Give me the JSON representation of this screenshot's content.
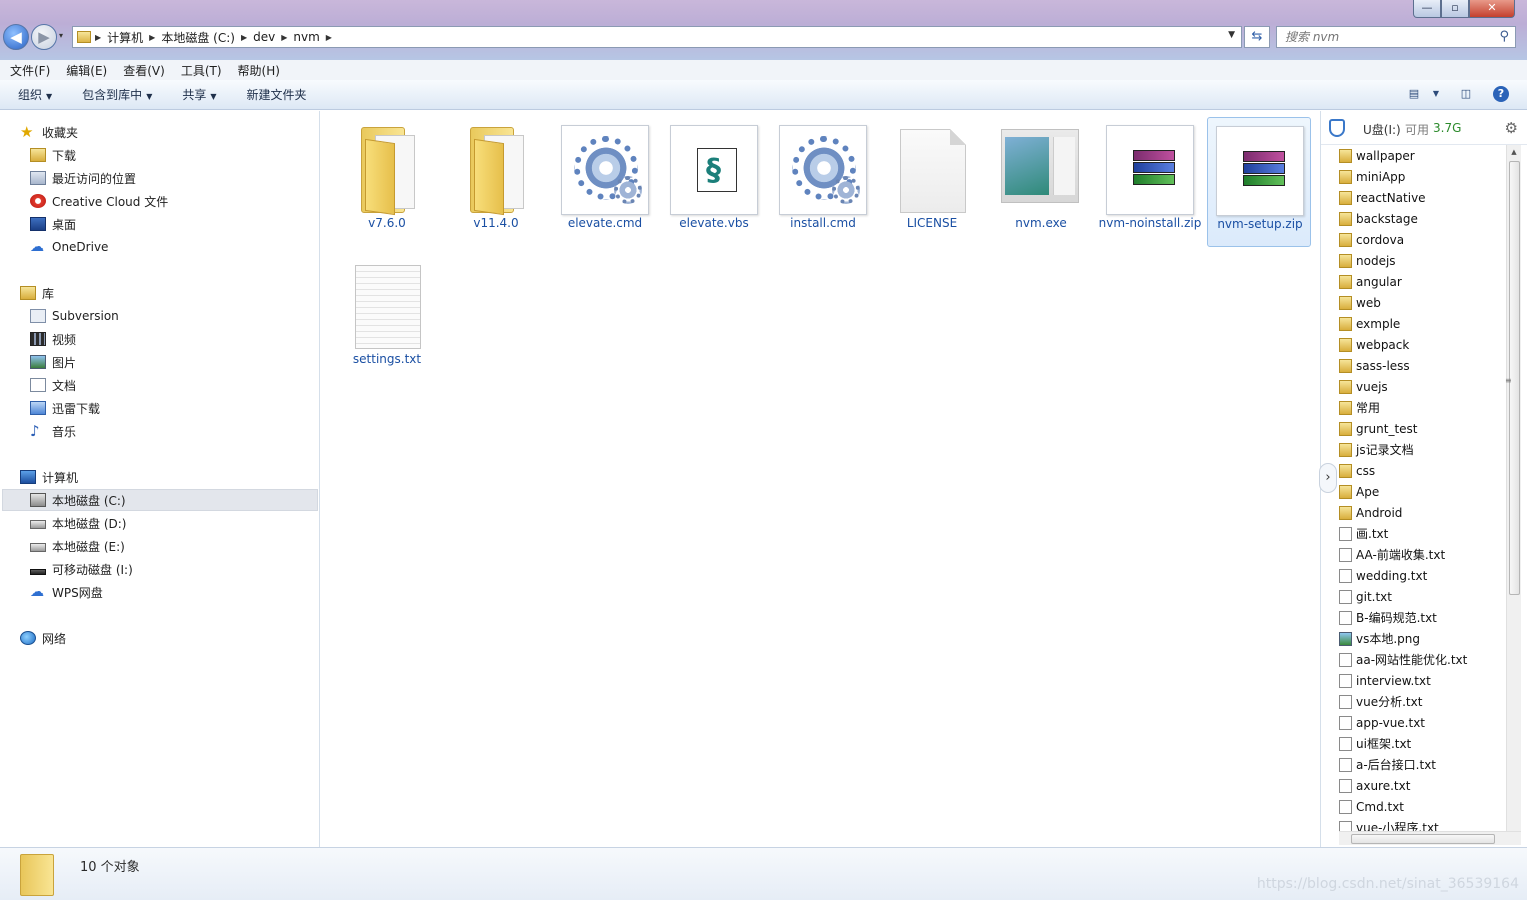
{
  "window": {
    "controls": {
      "minimize": "—",
      "maximize": "▫",
      "close": "✕"
    }
  },
  "navigation": {
    "back": "◀",
    "forward": "▶",
    "history": "▾",
    "breadcrumbs": [
      "计算机",
      "本地磁盘 (C:)",
      "dev",
      "nvm"
    ],
    "search_placeholder": "搜索 nvm"
  },
  "menubar": [
    "文件(F)",
    "编辑(E)",
    "查看(V)",
    "工具(T)",
    "帮助(H)"
  ],
  "commandbar": {
    "organize": "组织",
    "include_library": "包含到库中",
    "share": "共享",
    "new_folder": "新建文件夹"
  },
  "sidebar": {
    "favorites": {
      "header": "收藏夹",
      "items": [
        "下载",
        "最近访问的位置",
        "Creative Cloud 文件",
        "桌面",
        "OneDrive"
      ]
    },
    "libraries": {
      "header": "库",
      "items": [
        "Subversion",
        "视频",
        "图片",
        "文档",
        "迅雷下载",
        "音乐"
      ]
    },
    "computer": {
      "header": "计算机",
      "items": [
        "本地磁盘 (C:)",
        "本地磁盘 (D:)",
        "本地磁盘 (E:)",
        "可移动磁盘 (I:)",
        "WPS网盘"
      ],
      "selected": "本地磁盘 (C:)"
    },
    "network": {
      "header": "网络"
    }
  },
  "files": [
    {
      "name": "v7.6.0",
      "type": "folder"
    },
    {
      "name": "v11.4.0",
      "type": "folder"
    },
    {
      "name": "elevate.cmd",
      "type": "cmd"
    },
    {
      "name": "elevate.vbs",
      "type": "vbs"
    },
    {
      "name": "install.cmd",
      "type": "cmd"
    },
    {
      "name": "LICENSE",
      "type": "blank"
    },
    {
      "name": "nvm.exe",
      "type": "exe"
    },
    {
      "name": "nvm-noinstall.zip",
      "type": "zip"
    },
    {
      "name": "nvm-setup.zip",
      "type": "zip",
      "selected": true
    },
    {
      "name": "settings.txt",
      "type": "txt"
    }
  ],
  "preview": {
    "drive": "U盘(I:)",
    "free_label": "可用",
    "free_value": "3.7G",
    "items": [
      {
        "name": "wallpaper",
        "kind": "folder"
      },
      {
        "name": "miniApp",
        "kind": "folder"
      },
      {
        "name": "reactNative",
        "kind": "folder"
      },
      {
        "name": "backstage",
        "kind": "folder"
      },
      {
        "name": "cordova",
        "kind": "folder"
      },
      {
        "name": "nodejs",
        "kind": "folder"
      },
      {
        "name": "angular",
        "kind": "folder"
      },
      {
        "name": "web",
        "kind": "folder"
      },
      {
        "name": "exmple",
        "kind": "folder"
      },
      {
        "name": "webpack",
        "kind": "folder"
      },
      {
        "name": "sass-less",
        "kind": "folder"
      },
      {
        "name": "vuejs",
        "kind": "folder"
      },
      {
        "name": "常用",
        "kind": "folder"
      },
      {
        "name": "grunt_test",
        "kind": "folder"
      },
      {
        "name": "js记录文档",
        "kind": "folder"
      },
      {
        "name": "css",
        "kind": "folder"
      },
      {
        "name": "Ape",
        "kind": "folder"
      },
      {
        "name": "Android",
        "kind": "folder"
      },
      {
        "name": "画.txt",
        "kind": "file"
      },
      {
        "name": "AA-前端收集.txt",
        "kind": "file"
      },
      {
        "name": "wedding.txt",
        "kind": "file"
      },
      {
        "name": "git.txt",
        "kind": "file"
      },
      {
        "name": "B-编码规范.txt",
        "kind": "file"
      },
      {
        "name": "vs本地.png",
        "kind": "image"
      },
      {
        "name": "aa-网站性能优化.txt",
        "kind": "file"
      },
      {
        "name": "interview.txt",
        "kind": "file"
      },
      {
        "name": "vue分析.txt",
        "kind": "file"
      },
      {
        "name": "app-vue.txt",
        "kind": "file"
      },
      {
        "name": "ui框架.txt",
        "kind": "file"
      },
      {
        "name": "a-后台接口.txt",
        "kind": "file"
      },
      {
        "name": "axure.txt",
        "kind": "file"
      },
      {
        "name": "Cmd.txt",
        "kind": "file"
      },
      {
        "name": "vue-小程序.txt",
        "kind": "file"
      }
    ]
  },
  "status": {
    "count": "10 个对象"
  },
  "watermark": "https://blog.csdn.net/sinat_36539164"
}
